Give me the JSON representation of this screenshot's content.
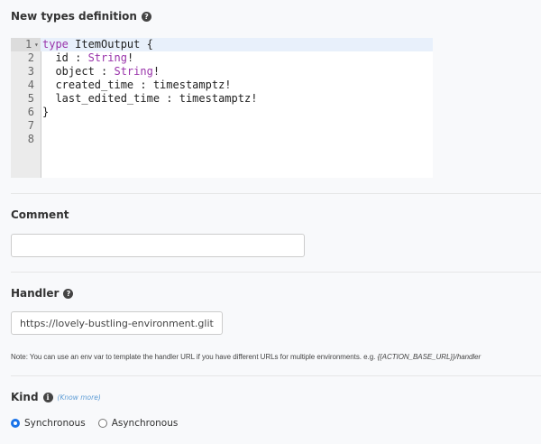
{
  "types": {
    "label": "New types definition",
    "help_icon": "question-circle-icon",
    "lines": [
      {
        "num": "1",
        "parts": [
          {
            "t": "type",
            "kw": true
          },
          {
            "t": " ItemOutput {"
          }
        ]
      },
      {
        "num": "2",
        "parts": [
          {
            "t": "  id : "
          },
          {
            "t": "String",
            "kw": true
          },
          {
            "t": "!"
          }
        ]
      },
      {
        "num": "3",
        "parts": [
          {
            "t": "  object : "
          },
          {
            "t": "String",
            "kw": true
          },
          {
            "t": "!"
          }
        ]
      },
      {
        "num": "4",
        "parts": [
          {
            "t": "  created_time : timestamptz!"
          }
        ]
      },
      {
        "num": "5",
        "parts": [
          {
            "t": "  last_edited_time : timestamptz!"
          }
        ]
      },
      {
        "num": "6",
        "parts": [
          {
            "t": "}"
          }
        ]
      },
      {
        "num": "7",
        "parts": []
      },
      {
        "num": "8",
        "parts": []
      }
    ]
  },
  "comment": {
    "label": "Comment",
    "value": ""
  },
  "handler": {
    "label": "Handler",
    "value": "https://lovely-bustling-environment.glitch.me/",
    "note": "Note: You can use an env var to template the handler URL if you have different URLs for multiple environments. e.g. ",
    "note_example": "{{ACTION_BASE_URL}}/handler"
  },
  "kind": {
    "label": "Kind",
    "info_icon": "info-circle-icon",
    "know_more": "(Know more)",
    "options": [
      {
        "label": "Synchronous",
        "selected": true
      },
      {
        "label": "Asynchronous",
        "selected": false
      }
    ]
  },
  "colors": {
    "accent": "#1a73e8",
    "keyword": "#9933aa",
    "link": "#5b9bd5"
  }
}
